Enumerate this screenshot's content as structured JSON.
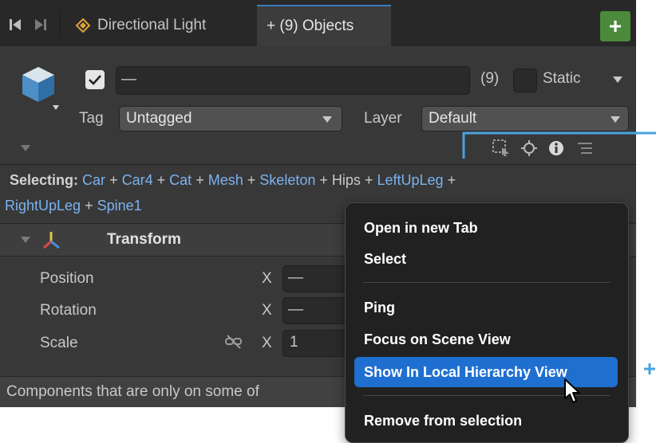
{
  "tabs": [
    {
      "label": "Directional Light",
      "icon": "directional-light-icon"
    },
    {
      "label": "+ (9) Objects",
      "icon": "plus-icon"
    }
  ],
  "toolbar": {
    "add_tab": "+"
  },
  "header": {
    "name_value": "—",
    "count": "(9)",
    "static_label": "Static",
    "tag_label": "Tag",
    "tag_value": "Untagged",
    "layer_label": "Layer",
    "layer_value": "Default"
  },
  "selecting": {
    "label": "Selecting:",
    "items": [
      "Car",
      "Car4",
      "Cat",
      "Mesh",
      "Skeleton",
      "Hips",
      "LeftUpLeg",
      "RightUpLeg",
      "Spine1"
    ],
    "linked": [
      true,
      true,
      true,
      true,
      true,
      false,
      true,
      true,
      true
    ],
    "separator": "+"
  },
  "transform": {
    "title": "Transform",
    "rows": [
      {
        "label": "Position",
        "axis": "X",
        "value": "—"
      },
      {
        "label": "Rotation",
        "axis": "X",
        "value": "—"
      },
      {
        "label": "Scale",
        "axis": "X",
        "value": "1"
      }
    ]
  },
  "footer": {
    "text": "Components that are only on some of"
  },
  "context_menu": {
    "items": [
      "Open in new Tab",
      "Select",
      "Ping",
      "Focus on Scene View",
      "Show In Local Hierarchy View",
      "Remove from selection"
    ],
    "highlighted": "Show In Local Hierarchy View"
  },
  "colors": {
    "panel": "#383838",
    "link": "#7cb2ef",
    "highlight": "#1f6fd0",
    "callout": "#4aa3df"
  }
}
